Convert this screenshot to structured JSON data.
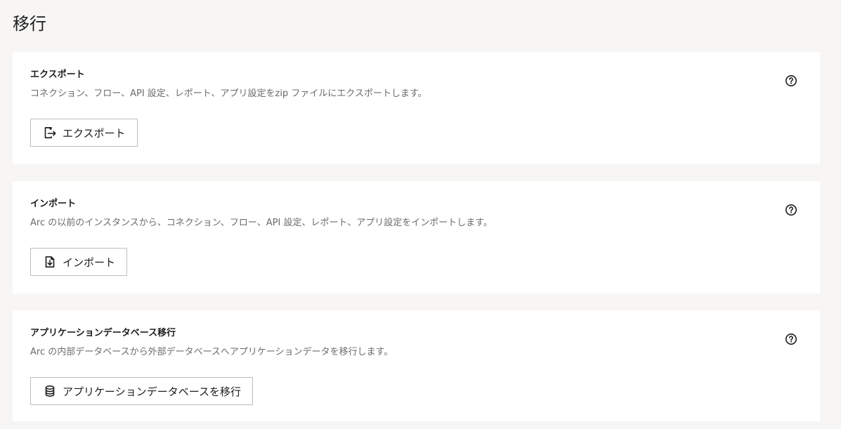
{
  "page": {
    "title": "移行"
  },
  "sections": {
    "export": {
      "title": "エクスポート",
      "description": "コネクション、フロー、API 設定、レポート、アプリ設定をzip ファイルにエクスポートします。",
      "button_label": "エクスポート",
      "button_icon": "file-export-icon",
      "help_icon": "help-circle-icon"
    },
    "import": {
      "title": "インポート",
      "description": "Arc の以前のインスタンスから、コネクション、フロー、API 設定、レポート、アプリ設定をインポートします。",
      "button_label": "インポート",
      "button_icon": "file-import-icon",
      "help_icon": "help-circle-icon"
    },
    "migrate": {
      "title": "アプリケーションデータベース移行",
      "description": "Arc の内部データベースから外部データベースへアプリケーションデータを移行します。",
      "button_label": "アプリケーションデータベースを移行",
      "button_icon": "database-icon",
      "help_icon": "help-circle-icon"
    }
  },
  "colors": {
    "background": "#f7f6f5",
    "card": "#ffffff",
    "text": "#1c1c1c",
    "muted_text": "#6b6b6b",
    "button_border": "#bdbdbd"
  }
}
